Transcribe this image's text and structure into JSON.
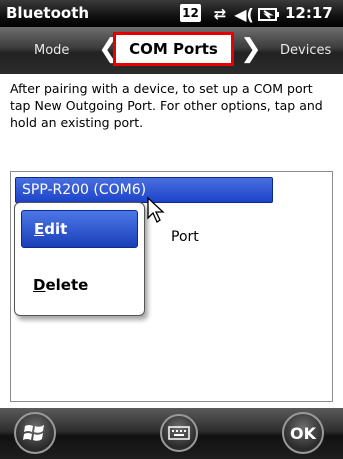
{
  "status_bar": {
    "title": "Bluetooth",
    "notification_badge": "12",
    "sync_icon": "sync-arrows-icon",
    "volume_icon": "speaker-icon",
    "battery_icon": "battery-charging-icon",
    "time": "12:17"
  },
  "tabs": {
    "left": "Mode",
    "active": "COM Ports",
    "right": "Devices",
    "highlight_color": "#e60000"
  },
  "content": {
    "instructions": "After pairing with a device, to set up a COM port tap New Outgoing Port. For other options, tap and hold an existing port.",
    "list": {
      "selected_item": "SPP-R200 (COM6)",
      "second_item_visible_text": "Port"
    }
  },
  "context_menu": {
    "edit_first": "E",
    "edit_rest": "dit",
    "delete_first": "D",
    "delete_rest": "elete"
  },
  "bottom_bar": {
    "start_icon": "windows-start-icon",
    "keyboard_icon": "keyboard-icon",
    "ok_label": "OK"
  },
  "colors": {
    "selection_blue": "#1c43c8",
    "tab_highlight": "#e60000"
  }
}
